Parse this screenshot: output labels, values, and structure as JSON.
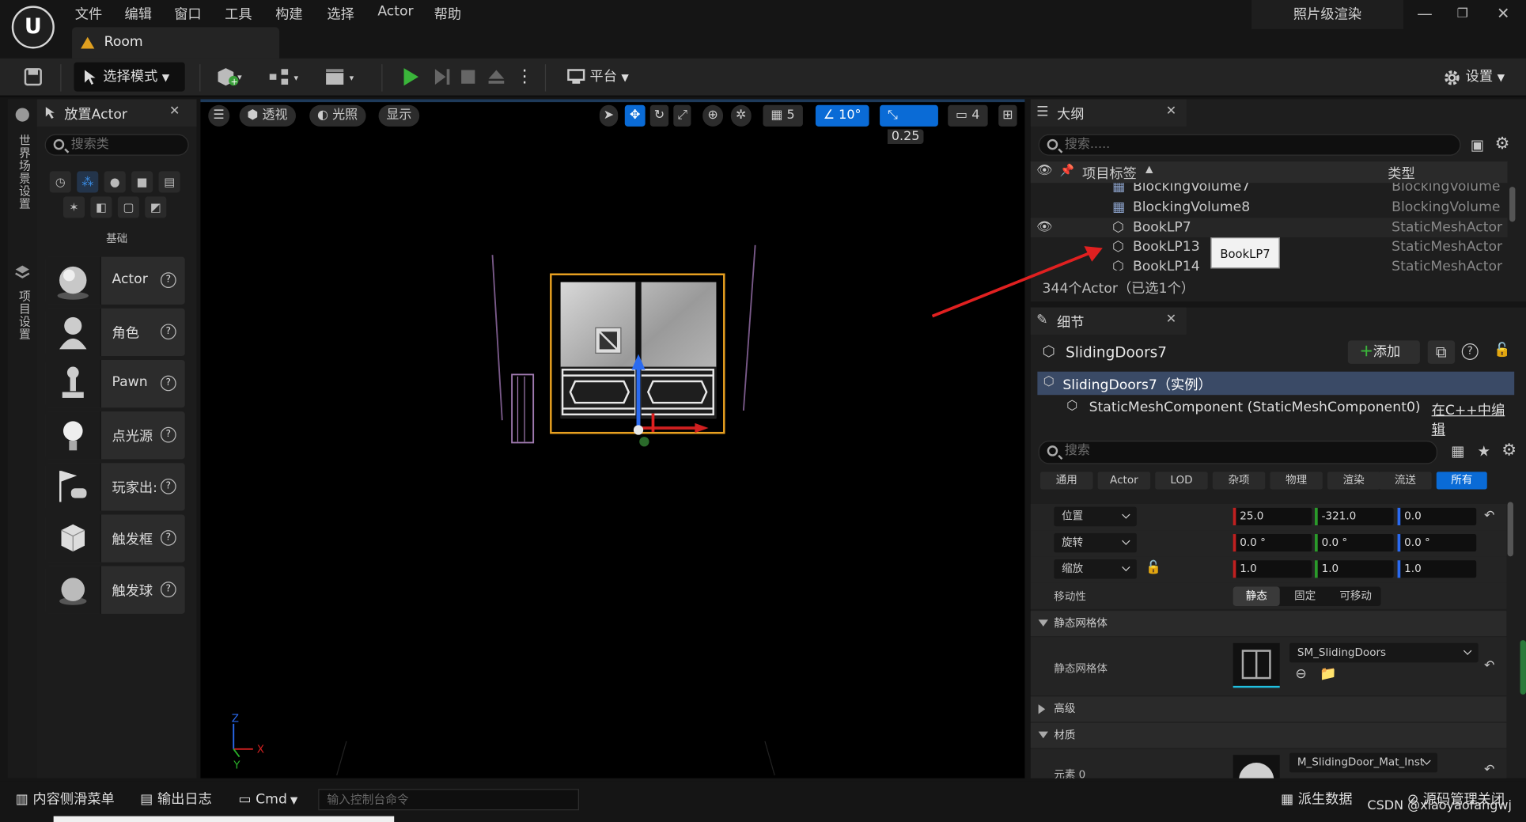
{
  "title_bar": {
    "menu": [
      "文件",
      "编辑",
      "窗口",
      "工具",
      "构建",
      "选择",
      "Actor",
      "帮助"
    ],
    "level_tab": "Room",
    "render_mode": "照片级渲染"
  },
  "toolbar": {
    "select_mode": "选择模式",
    "platform": "平台",
    "settings": "设置"
  },
  "left_strip": {
    "world_settings": "世界场景设置",
    "project_settings": "项目设置"
  },
  "place_actor": {
    "title": "放置Actor",
    "search_placeholder": "搜索类",
    "category": "基础",
    "items": [
      "Actor",
      "角色",
      "Pawn",
      "点光源",
      "玩家出:",
      "触发框",
      "触发球"
    ]
  },
  "viewport": {
    "perspective": "透视",
    "lit": "光照",
    "show": "显示",
    "grid_snap": "5",
    "rotation_snap": "10°",
    "scale_snap": "0.25",
    "camera_speed": "4"
  },
  "outline": {
    "title": "大纲",
    "search_placeholder": "搜索.....",
    "col_label": "项目标签",
    "col_type": "类型",
    "rows": [
      {
        "label": "BlockingVolume7",
        "type": "BlockingVolume"
      },
      {
        "label": "BlockingVolume8",
        "type": "BlockingVolume"
      },
      {
        "label": "BookLP7",
        "type": "StaticMeshActor"
      },
      {
        "label": "BookLP13",
        "type": "StaticMeshActor"
      },
      {
        "label": "BookLP14",
        "type": "StaticMeshActor"
      }
    ],
    "tooltip": "BookLP7",
    "status": "344个Actor（已选1个）"
  },
  "details": {
    "title": "细节",
    "actor_name": "SlidingDoors7",
    "add_button": "添加",
    "instance_row": "SlidingDoors7（实例）",
    "component": "StaticMeshComponent (StaticMeshComponent0)",
    "edit_cpp": "在C++中编辑",
    "search_placeholder": "搜索",
    "tabs": [
      "通用",
      "Actor",
      "LOD",
      "杂项",
      "物理",
      "渲染",
      "流送",
      "所有"
    ],
    "transform": {
      "location_label": "位置",
      "location": [
        "25.0",
        "-321.0",
        "0.0"
      ],
      "rotation_label": "旋转",
      "rotation": [
        "0.0 °",
        "0.0 °",
        "0.0 °"
      ],
      "scale_label": "缩放",
      "scale": [
        "1.0",
        "1.0",
        "1.0"
      ]
    },
    "mobility_label": "移动性",
    "mobility_options": [
      "静态",
      "固定",
      "可移动"
    ],
    "section_static_mesh": "静态网格体",
    "static_mesh_label": "静态网格体",
    "static_mesh_value": "SM_SlidingDoors",
    "section_advanced": "高级",
    "section_materials": "材质",
    "element0_label": "元素 0",
    "element0_value": "M_SlidingDoor_Mat_Inst"
  },
  "status_bar": {
    "content_drawer": "内容侧滑菜单",
    "output_log": "输出日志",
    "cmd": "Cmd",
    "console_placeholder": "输入控制台命令",
    "derived_data": "派生数据",
    "source_control": "源码管理关闭"
  },
  "watermark": "CSDN @xiaoyaofangwj",
  "colors": {
    "accent_blue": "#0a6bd6",
    "selection_orange": "#e8a020",
    "arrow_red": "#e02020"
  }
}
